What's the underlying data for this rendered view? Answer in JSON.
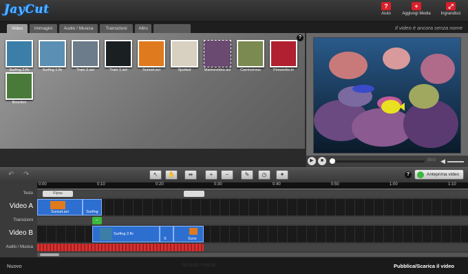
{
  "app": {
    "logo": "JayCut"
  },
  "header": {
    "buttons": [
      {
        "label": "Aiuto",
        "icon": "help-icon",
        "glyph": "?"
      },
      {
        "label": "Aggiungi Media",
        "icon": "camera-plus-icon",
        "glyph": "+"
      },
      {
        "label": "Ingrandisci",
        "icon": "maximize-icon",
        "glyph": "⤢"
      }
    ]
  },
  "tabs": [
    {
      "label": "Video",
      "active": true
    },
    {
      "label": "Immagini",
      "active": false
    },
    {
      "label": "Audio / Musica",
      "active": false
    },
    {
      "label": "Transizioni",
      "active": false
    },
    {
      "label": "Altro",
      "active": false
    },
    {
      "label": "",
      "active": false
    }
  ],
  "project_title": "Il video è ancora senza nome",
  "library": {
    "items": [
      {
        "label": "Surfing 2.flv",
        "color": "#3b7ea8"
      },
      {
        "label": "Surfing 1.flv",
        "color": "#5b8fb4"
      },
      {
        "label": "Train 2.avi",
        "color": "#6d7c8a"
      },
      {
        "label": "Train 1.avi",
        "color": "#1a1f22"
      },
      {
        "label": "Sunset.avi",
        "color": "#e07a1e"
      },
      {
        "label": "Spotted",
        "color": "#d8d0c0"
      },
      {
        "label": "Marinevideo.avi",
        "color": "#6a4a70"
      },
      {
        "label": "Carnivorous",
        "color": "#7a8a50"
      },
      {
        "label": "Fireworks.in",
        "color": "#b02030"
      },
      {
        "label": "Bourdon",
        "color": "#4a7a3a"
      }
    ]
  },
  "player": {
    "progress": 0.05,
    "time": "00:0"
  },
  "toolbar": {
    "preview_label": "Anteprima video"
  },
  "timeline": {
    "ruler": [
      "0:00",
      "0:10",
      "0:20",
      "0:30",
      "0:40",
      "0:50",
      "1:00",
      "1:10"
    ],
    "tracks": {
      "text": "Testo",
      "video_a": "Video A",
      "transitions": "Transizioni",
      "video_b": "Video B",
      "audio": "Audio / Musica"
    },
    "text_clip": "Flyou",
    "video_a_clips": [
      {
        "label": "Sunset.avi"
      },
      {
        "label": "Surfing"
      }
    ],
    "video_b_clips": [
      {
        "label": "Surfing 2.flv"
      },
      {
        "label": "S"
      },
      {
        "label": "Suns"
      }
    ]
  },
  "footer": {
    "new_label": "Nuovo",
    "center_text": "00:00:00 / 0:00:00",
    "publish_label": "Pubblica/Scarica il video"
  },
  "colors": {
    "accent": "#2d6fd0",
    "brand_red": "#d8202a",
    "audio_track": "#d83030"
  }
}
